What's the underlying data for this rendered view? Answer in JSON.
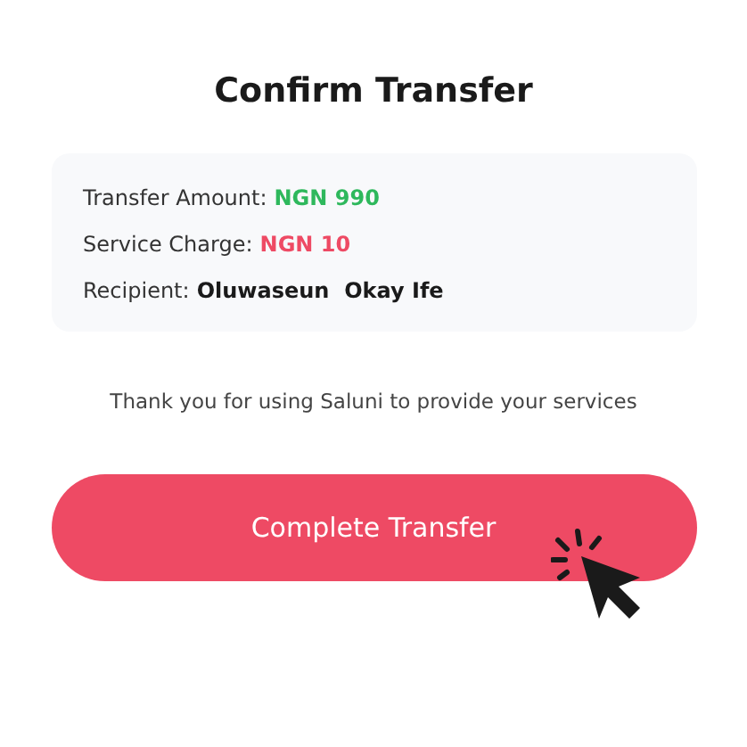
{
  "title": "Confirm Transfer",
  "details": [
    {
      "label": "Transfer Amount:",
      "value": "NGN 990",
      "color": "#2eb85c"
    },
    {
      "label": "Service Charge:",
      "value": "NGN 10",
      "color": "#ee4a64"
    },
    {
      "label": "Recipient:",
      "value": "Oluwaseun  Okay Ife",
      "color": "#1a1a1a"
    }
  ],
  "note": "Thank you for using Saluni to provide your services",
  "button": "Complete Transfer"
}
